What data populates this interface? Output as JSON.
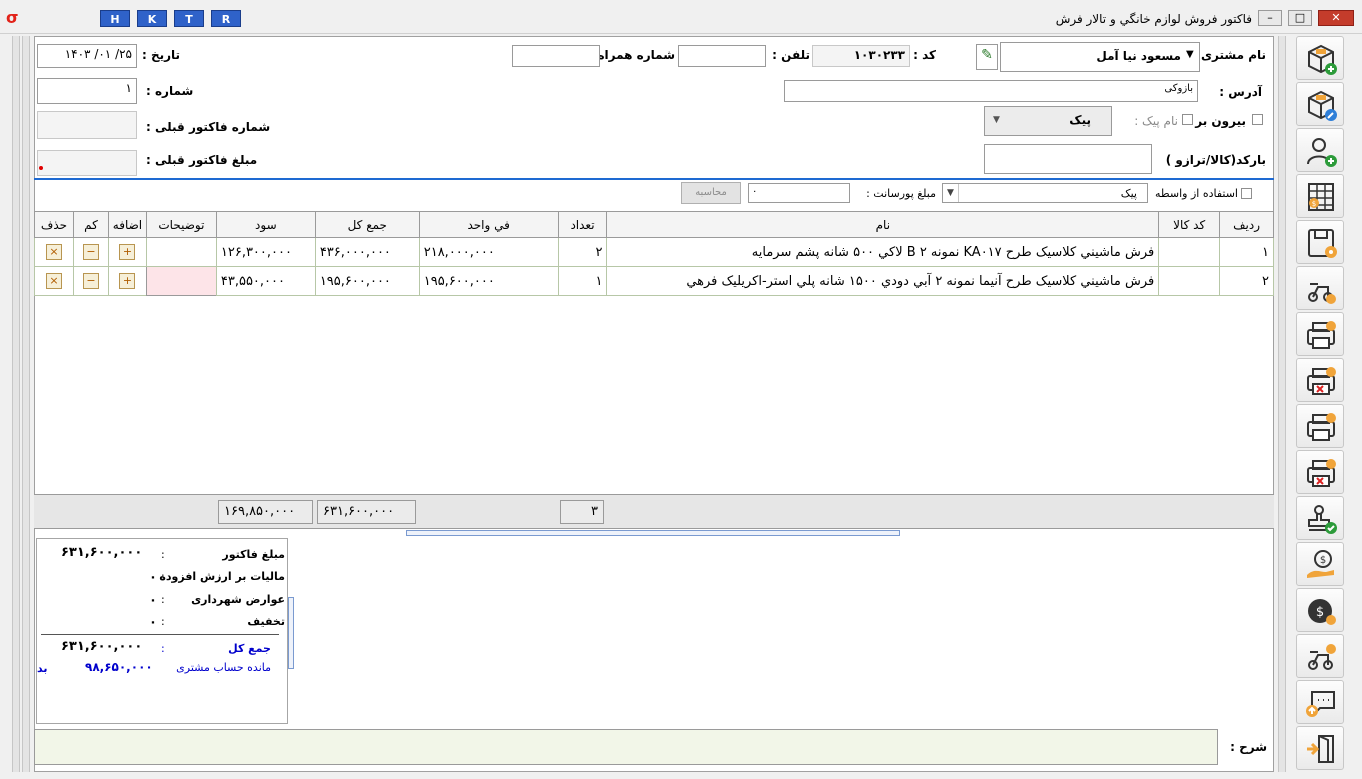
{
  "window": {
    "title": "فاکتور فروش لوازم خانگي و تالار فرش",
    "hotkeys": [
      "H",
      "K",
      "T",
      "R"
    ]
  },
  "header": {
    "customer_label": "نام مشتری :",
    "customer_name": "مسعود نیا آمل",
    "code_label": "کد :",
    "code_value": "۱۰۳۰۲۳۳",
    "phone_label": "تلفن :",
    "phone_value": "",
    "mobile_label": "شماره همراه :",
    "mobile_value": "",
    "date_label": "تاریخ :",
    "date_value": "۲۵/ ۰۱/ ۱۴۰۳",
    "address_label": "آدرس :",
    "address_value": "بازوکی",
    "number_label": "شماره :",
    "number_value": "۱",
    "prev_invoice_label": "شماره فاکتور قبلی :",
    "prev_invoice_value": "",
    "prev_amount_label": "مبلغ فاکتور قبلی :",
    "outside_label": "بیرون بر",
    "courier_name_label": "نام پیک :",
    "courier_value": "پیک",
    "barcode_label": "بارکد(کالا/ترازو )",
    "barcode_value": ""
  },
  "broker": {
    "use_broker_label": "استفاده از واسطه",
    "broker_value": "پیک",
    "commission_label": "مبلغ پورسانت :",
    "commission_value": "۰",
    "calculate_label": "محاسبه"
  },
  "grid": {
    "columns": [
      "ردیف",
      "کد کالا",
      "نام",
      "تعداد",
      "في واحد",
      "جمع کل",
      "سود",
      "توضیحات",
      "اضافه",
      "کم",
      "حذف"
    ],
    "rows": [
      {
        "row": "۱",
        "code": "",
        "name": "فرش ماشيني کلاسيک طرح KA۰۱۷ نمونه ۲ B لاکي ۵۰۰ شانه پشم سرمايه",
        "qty": "۲",
        "unit_price": "۲۱۸,۰۰۰,۰۰۰",
        "total": "۴۳۶,۰۰۰,۰۰۰",
        "profit": "۱۲۶,۳۰۰,۰۰۰",
        "desc": ""
      },
      {
        "row": "۲",
        "code": "",
        "name": "فرش ماشيني کلاسيک طرح آنيما نمونه ۲ آبي دودي ۱۵۰۰ شانه پلي استر-اکريليک فرهي",
        "qty": "۱",
        "unit_price": "۱۹۵,۶۰۰,۰۰۰",
        "total": "۱۹۵,۶۰۰,۰۰۰",
        "profit": "۴۳,۵۵۰,۰۰۰",
        "desc": ""
      }
    ],
    "totals": {
      "qty": "۳",
      "total": "۶۳۱,۶۰۰,۰۰۰",
      "profit": "۱۶۹,۸۵۰,۰۰۰"
    }
  },
  "summary": {
    "invoice_amount_label": "مبلغ فاکتور",
    "invoice_amount": "۶۳۱,۶۰۰,۰۰۰",
    "vat_label": "مالیات بر ارزش افزوده",
    "vat": "۰",
    "municipal_label": "عوارض شهرداری",
    "municipal": "۰",
    "discount_label": "تخفیف",
    "discount": "۰",
    "grand_total_label": "جمع کل",
    "grand_total": "۶۳۱,۶۰۰,۰۰۰",
    "balance_label": "مانده حساب مشتری",
    "balance": "۹۸,۶۵۰,۰۰۰",
    "balance_suffix": "بد"
  },
  "footer": {
    "sharh_label": "شرح :",
    "sharh_value": ""
  },
  "toolbar": {
    "buttons": [
      "new-invoice",
      "edit-invoice",
      "add-customer",
      "price-calculator",
      "save-view",
      "delivery-view",
      "print-invoice",
      "cancel-print",
      "print-draft",
      "cancel-draft",
      "stamp-approve",
      "payment",
      "currency",
      "delivery-payment",
      "send-message",
      "exit"
    ]
  },
  "colors": {
    "hotkey_blue": "#2f62c9",
    "close_red": "#c43c2b",
    "link_blue": "#0000cc",
    "required_red": "#e00000"
  }
}
